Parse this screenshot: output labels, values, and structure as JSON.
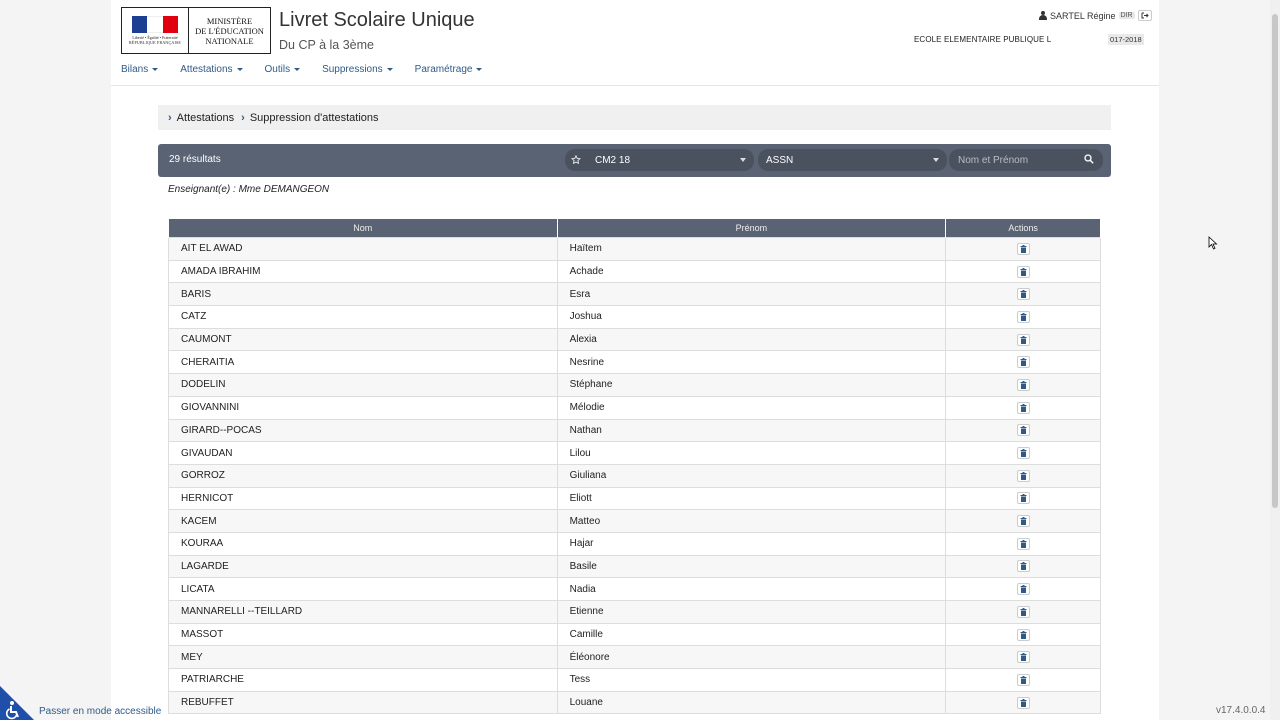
{
  "header": {
    "ministry_line1": "MINISTÈRE",
    "ministry_line2": "DE L'ÉDUCATION",
    "ministry_line3": "NATIONALE",
    "motto": "Liberté • Égalité • Fraternité",
    "republic": "RÉPUBLIQUE FRANÇAISE",
    "app_title": "Livret Scolaire Unique",
    "app_subtitle": "Du CP à la 3ème",
    "user_name": "SARTEL Régine",
    "user_role": "DIR",
    "school": "ECOLE ELEMENTAIRE PUBLIQUE L",
    "year": "017-2018"
  },
  "nav": {
    "items": [
      {
        "label": "Bilans"
      },
      {
        "label": "Attestations"
      },
      {
        "label": "Outils"
      },
      {
        "label": "Suppressions"
      },
      {
        "label": "Paramétrage"
      }
    ]
  },
  "breadcrumb": {
    "items": [
      "Attestations",
      "Suppression d'attestations"
    ]
  },
  "filters": {
    "results": "29 résultats",
    "class_value": "CM2 18",
    "period_value": "ASSN",
    "search_placeholder": "Nom et Prénom"
  },
  "teacher": "Enseignant(e) : Mme DEMANGEON",
  "table": {
    "headers": {
      "nom": "Nom",
      "prenom": "Prénom",
      "actions": "Actions"
    },
    "rows": [
      {
        "nom": "AIT EL AWAD",
        "prenom": "Haïtem"
      },
      {
        "nom": "AMADA IBRAHIM",
        "prenom": "Achade"
      },
      {
        "nom": "BARIS",
        "prenom": "Esra"
      },
      {
        "nom": "CATZ",
        "prenom": "Joshua"
      },
      {
        "nom": "CAUMONT",
        "prenom": "Alexia"
      },
      {
        "nom": "CHERAITIA",
        "prenom": "Nesrine"
      },
      {
        "nom": "DODELIN",
        "prenom": "Stéphane"
      },
      {
        "nom": "GIOVANNINI",
        "prenom": "Mélodie"
      },
      {
        "nom": "GIRARD--POCAS",
        "prenom": "Nathan"
      },
      {
        "nom": "GIVAUDAN",
        "prenom": "Lilou"
      },
      {
        "nom": "GORROZ",
        "prenom": "Giuliana"
      },
      {
        "nom": "HERNICOT",
        "prenom": "Eliott"
      },
      {
        "nom": "KACEM",
        "prenom": "Matteo"
      },
      {
        "nom": "KOURAA",
        "prenom": "Hajar"
      },
      {
        "nom": "LAGARDE",
        "prenom": "Basile"
      },
      {
        "nom": "LICATA",
        "prenom": "Nadia"
      },
      {
        "nom": "MANNARELLI --TEILLARD",
        "prenom": "Etienne"
      },
      {
        "nom": "MASSOT",
        "prenom": "Camille"
      },
      {
        "nom": "MEY",
        "prenom": "Éléonore"
      },
      {
        "nom": "PATRIARCHE",
        "prenom": "Tess"
      },
      {
        "nom": "REBUFFET",
        "prenom": "Louane"
      }
    ]
  },
  "footer": {
    "accessible_mode": "Passer en mode accessible",
    "version": "v17.4.0.0.4"
  },
  "colors": {
    "brand_blue": "#2f5a88",
    "bar_grey": "#5a6373",
    "accessibility_blue": "#1f4fa8"
  }
}
